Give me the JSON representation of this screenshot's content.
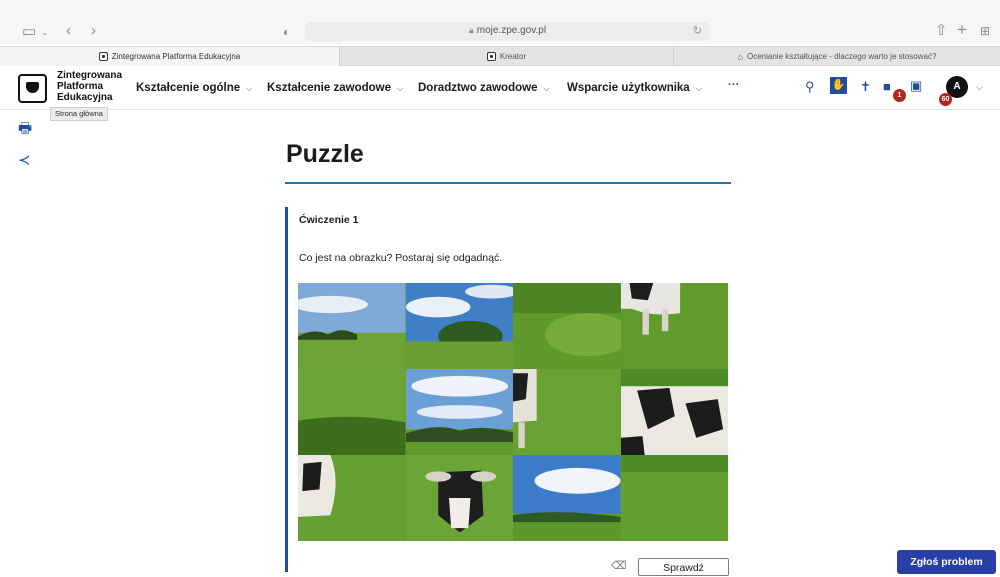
{
  "browser": {
    "url": "moje.zpe.gov.pl",
    "tabs": [
      {
        "label": "Zintegrowana Platforma Edukacyjna"
      },
      {
        "label": "Kreator"
      },
      {
        "label": "Ocenianie kształtujące - dlaczego warto je stosować?"
      }
    ]
  },
  "header": {
    "logo_text": "Zintegrowana Platforma Edukacyjna",
    "nav": [
      {
        "label": "Kształcenie ogólne"
      },
      {
        "label": "Kształcenie zawodowe"
      },
      {
        "label": "Doradztwo zawodowe"
      },
      {
        "label": "Wsparcie użytkownika"
      },
      {
        "label": "···"
      }
    ],
    "notifications_badge": "1",
    "messages_badge": "60",
    "avatar_initial": "A",
    "tooltip": "Strona główna"
  },
  "main": {
    "title": "Puzzle",
    "exercise_label": "Ćwiczenie 1",
    "question": "Co jest na obrazku? Postaraj się odgadnąć.",
    "check_button": "Sprawdź"
  },
  "report_button": "Zgłoś problem",
  "colors": {
    "accent": "#1f4e9c",
    "rule": "#1f6fb3",
    "report": "#273fa6",
    "badge": "#b3261e"
  }
}
